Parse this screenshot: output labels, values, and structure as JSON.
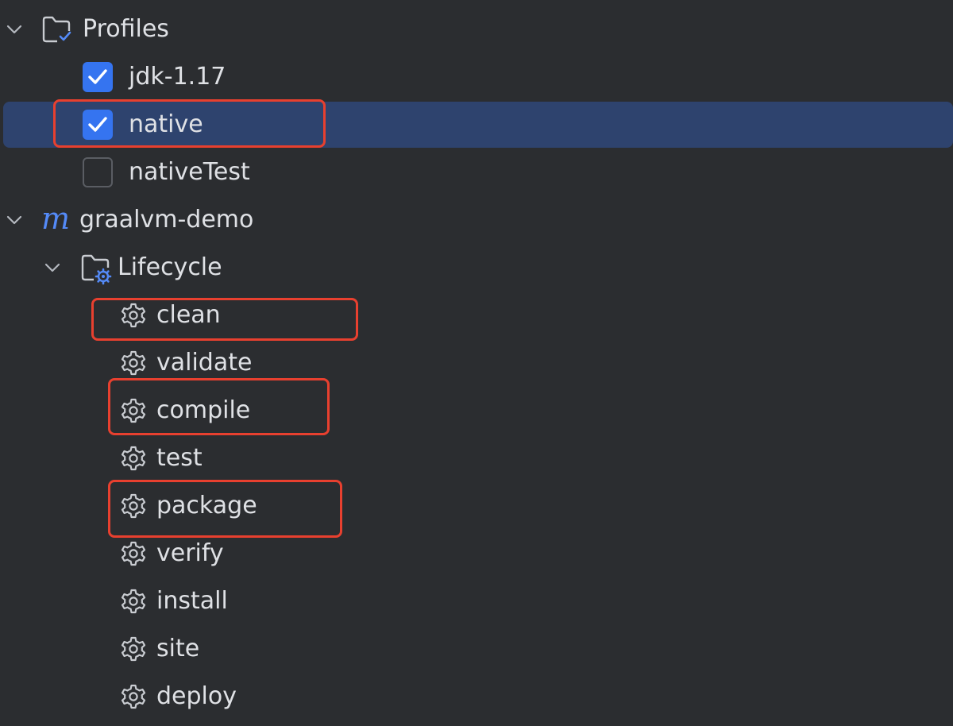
{
  "profiles": {
    "label": "Profiles",
    "icon": "folder-check-icon",
    "items": [
      {
        "label": "jdk-1.17",
        "checked": true
      },
      {
        "label": "native",
        "checked": true,
        "selected": true
      },
      {
        "label": "nativeTest",
        "checked": false
      }
    ]
  },
  "project": {
    "label": "graalvm-demo",
    "icon_glyph": "m",
    "icon": "maven-icon",
    "lifecycle": {
      "label": "Lifecycle",
      "icon": "folder-gear-icon",
      "goals": [
        {
          "label": "clean"
        },
        {
          "label": "validate"
        },
        {
          "label": "compile"
        },
        {
          "label": "test"
        },
        {
          "label": "package"
        },
        {
          "label": "verify"
        },
        {
          "label": "install"
        },
        {
          "label": "site"
        },
        {
          "label": "deploy"
        }
      ]
    }
  },
  "colors": {
    "background": "#2b2d30",
    "selection": "#2e436e",
    "checkbox_accent": "#3574f0",
    "annotation": "#e8402f",
    "maven_blue": "#548af7"
  }
}
